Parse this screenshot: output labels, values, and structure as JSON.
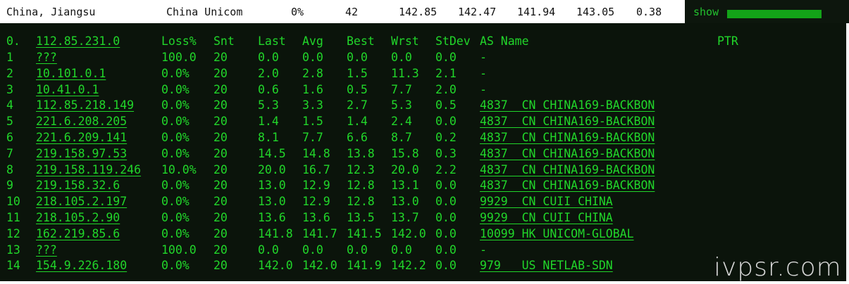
{
  "topbar": {
    "location": "China, Jiangsu",
    "isp": "China Unicom",
    "loss": "0%",
    "sent": "42",
    "last": "142.85",
    "avg": "142.47",
    "best": "141.94",
    "worst": "143.05",
    "stdev": "0.38",
    "show_label": "show"
  },
  "header": {
    "hop": "0.",
    "host": "112.85.231.0",
    "loss": "Loss%",
    "snt": "Snt",
    "last": "Last",
    "avg": "Avg",
    "best": "Best",
    "wrst": "Wrst",
    "stdev": "StDev",
    "as_name": "AS Name",
    "ptr": "PTR"
  },
  "hops": [
    {
      "hop": "1",
      "host": "???",
      "loss": "100.0",
      "snt": "20",
      "last": "0.0",
      "avg": "0.0",
      "best": "0.0",
      "wrst": "0.0",
      "stdev": "0.0",
      "as": "-"
    },
    {
      "hop": "2",
      "host": "10.101.0.1",
      "loss": "0.0%",
      "snt": "20",
      "last": "2.0",
      "avg": "2.8",
      "best": "1.5",
      "wrst": "11.3",
      "stdev": "2.1",
      "as": "-"
    },
    {
      "hop": "3",
      "host": "10.41.0.1",
      "loss": "0.0%",
      "snt": "20",
      "last": "0.6",
      "avg": "1.6",
      "best": "0.5",
      "wrst": "7.7",
      "stdev": "2.0",
      "as": "-"
    },
    {
      "hop": "4",
      "host": "112.85.218.149",
      "loss": "0.0%",
      "snt": "20",
      "last": "5.3",
      "avg": "3.3",
      "best": "2.7",
      "wrst": "5.3",
      "stdev": "0.5",
      "as": "4837  CN CHINA169-BACKBON"
    },
    {
      "hop": "5",
      "host": "221.6.208.205",
      "loss": "0.0%",
      "snt": "20",
      "last": "1.4",
      "avg": "1.5",
      "best": "1.4",
      "wrst": "2.4",
      "stdev": "0.0",
      "as": "4837  CN CHINA169-BACKBON"
    },
    {
      "hop": "6",
      "host": "221.6.209.141",
      "loss": "0.0%",
      "snt": "20",
      "last": "8.1",
      "avg": "7.7",
      "best": "6.6",
      "wrst": "8.7",
      "stdev": "0.2",
      "as": "4837  CN CHINA169-BACKBON"
    },
    {
      "hop": "7",
      "host": "219.158.97.53",
      "loss": "0.0%",
      "snt": "20",
      "last": "14.5",
      "avg": "14.8",
      "best": "13.8",
      "wrst": "15.8",
      "stdev": "0.3",
      "as": "4837  CN CHINA169-BACKBON"
    },
    {
      "hop": "8",
      "host": "219.158.119.246",
      "loss": "10.0%",
      "snt": "20",
      "last": "20.0",
      "avg": "16.7",
      "best": "12.3",
      "wrst": "20.0",
      "stdev": "2.2",
      "as": "4837  CN CHINA169-BACKBON"
    },
    {
      "hop": "9",
      "host": "219.158.32.6",
      "loss": "0.0%",
      "snt": "20",
      "last": "13.0",
      "avg": "12.9",
      "best": "12.8",
      "wrst": "13.1",
      "stdev": "0.0",
      "as": "4837  CN CHINA169-BACKBON"
    },
    {
      "hop": "10",
      "host": "218.105.2.197",
      "loss": "0.0%",
      "snt": "20",
      "last": "13.0",
      "avg": "12.9",
      "best": "12.8",
      "wrst": "13.0",
      "stdev": "0.0",
      "as": "9929  CN CUII CHINA"
    },
    {
      "hop": "11",
      "host": "218.105.2.90",
      "loss": "0.0%",
      "snt": "20",
      "last": "13.6",
      "avg": "13.6",
      "best": "13.5",
      "wrst": "13.7",
      "stdev": "0.0",
      "as": "9929  CN CUII CHINA"
    },
    {
      "hop": "12",
      "host": "162.219.85.6",
      "loss": "0.0%",
      "snt": "20",
      "last": "141.8",
      "avg": "141.7",
      "best": "141.5",
      "wrst": "142.0",
      "stdev": "0.0",
      "as": "10099 HK UNICOM-GLOBAL"
    },
    {
      "hop": "13",
      "host": "???",
      "loss": "100.0",
      "snt": "20",
      "last": "0.0",
      "avg": "0.0",
      "best": "0.0",
      "wrst": "0.0",
      "stdev": "0.0",
      "as": "-"
    },
    {
      "hop": "14",
      "host": "154.9.226.180",
      "loss": "0.0%",
      "snt": "20",
      "last": "142.0",
      "avg": "142.0",
      "best": "141.9",
      "wrst": "142.2",
      "stdev": "0.0",
      "as": "979   US NETLAB-SDN"
    }
  ],
  "watermark": "ivpsr.com"
}
